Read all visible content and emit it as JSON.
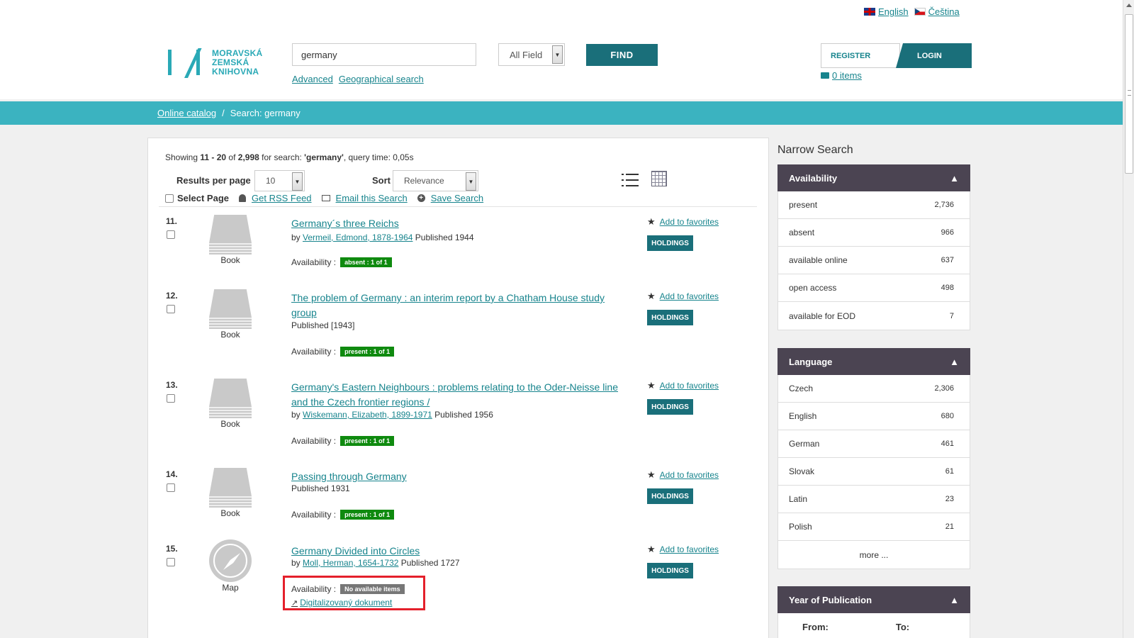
{
  "header": {
    "languages": [
      {
        "label": "English",
        "flag": "uk-flag-icon"
      },
      {
        "label": "Čeština",
        "flag": "cz-flag-icon"
      }
    ],
    "logo_lines": [
      "MORAVSKÁ",
      "ZEMSKÁ",
      "KNIHOVNA"
    ],
    "search": {
      "value": "germany",
      "placeholder": ""
    },
    "field_select": "All Field",
    "find_label": "FIND",
    "links": {
      "advanced": "Advanced",
      "geo": "Geographical search"
    },
    "register_label": "REGISTER",
    "login_label": "LOGIN",
    "cart_label": "0 items"
  },
  "breadcrumb": {
    "home": "Online catalog",
    "separator": "/",
    "current": "Search: germany"
  },
  "results": {
    "showing": {
      "prefix": "Showing ",
      "range": "11 - 20",
      "of": " of ",
      "total": "2,998",
      "for": " for search: ",
      "query": "'germany'",
      "time": ", query time: 0,05s"
    },
    "rpp_label": "Results per page",
    "rpp_value": "10",
    "sort_label": "Sort",
    "sort_value": "Relevance",
    "select_page": "Select Page",
    "rss": "Get RSS Feed",
    "email": "Email this Search",
    "save": "Save Search",
    "avail_label": "Availability :",
    "fav_label": "Add to favorites",
    "holdings_label": "HOLDINGS",
    "records": [
      {
        "num": "11.",
        "type": "Book",
        "title": "Germany´s three Reichs",
        "by": "by ",
        "author": "Vermeil, Edmond, 1878-1964",
        "published": " Published 1944",
        "badge": "absent : 1 of 1"
      },
      {
        "num": "12.",
        "type": "Book",
        "title": "The problem of Germany : an interim report by a Chatham House study group",
        "published": "Published [1943]",
        "badge": "present : 1 of 1"
      },
      {
        "num": "13.",
        "type": "Book",
        "title": "Germany's Eastern Neighbours : problems relating to the Oder-Neisse line and the Czech frontier regions /",
        "by": "by ",
        "author": "Wiskemann, Elizabeth, 1899-1971",
        "published": " Published 1956",
        "badge": "present : 1 of 1"
      },
      {
        "num": "14.",
        "type": "Book",
        "title": "Passing through Germany",
        "published": "Published 1931",
        "badge": "present : 1 of 1"
      },
      {
        "num": "15.",
        "type": "Map",
        "title": "Germany Divided into Circles",
        "by": "by ",
        "author": "Moll, Herman, 1654-1732",
        "published": " Published 1727",
        "badge": "No available items",
        "digital_link": "Digitalizovaný dokument"
      }
    ]
  },
  "sidebar": {
    "title": "Narrow Search",
    "facets": [
      {
        "name": "Availability",
        "items": [
          {
            "label": "present",
            "count": "2,736"
          },
          {
            "label": "absent",
            "count": "966"
          },
          {
            "label": "available online",
            "count": "637"
          },
          {
            "label": "open access",
            "count": "498"
          },
          {
            "label": "available for EOD",
            "count": "7"
          }
        ]
      },
      {
        "name": "Language",
        "items": [
          {
            "label": "Czech",
            "count": "2,306"
          },
          {
            "label": "English",
            "count": "680"
          },
          {
            "label": "German",
            "count": "461"
          },
          {
            "label": "Slovak",
            "count": "61"
          },
          {
            "label": "Latin",
            "count": "23"
          },
          {
            "label": "Polish",
            "count": "21"
          }
        ],
        "more": "more ..."
      },
      {
        "name": "Year of Publication",
        "from_label": "From:",
        "to_label": "To:"
      }
    ],
    "collapse_glyph": "▲"
  },
  "colors": {
    "teal": "#3bb3c0",
    "dark_teal": "#1a6f7a",
    "facet_head": "#4b4452",
    "green_badge": "#0f8a0f",
    "highlight": "#e4202b"
  }
}
